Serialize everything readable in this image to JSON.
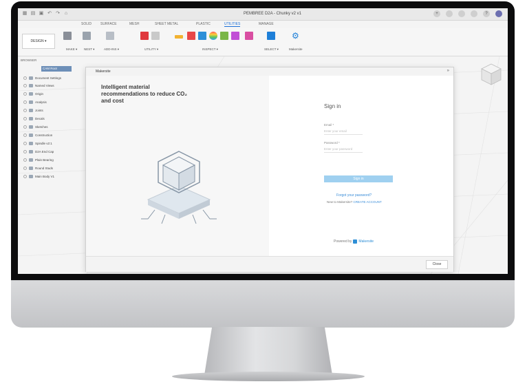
{
  "window": {
    "title": "PEMBREE D2A - Chunky v2 v1"
  },
  "tabs": [
    "SOLID",
    "SURFACE",
    "MESH",
    "SHEET METAL",
    "PLASTIC",
    "UTILITIES",
    "MANAGE"
  ],
  "active_tab": "UTILITIES",
  "toolbar": {
    "design_label": "DESIGN ▾",
    "groups": [
      "MAKE ▾",
      "NEST ▾",
      "ADD-INS ▾",
      "UTILITY ▾",
      "INSPECT ▾",
      "SELECT ▾",
      "Makersite"
    ]
  },
  "browser": {
    "header": "BROWSER",
    "root": "CAM Root",
    "items": [
      "Document Settings",
      "Named Views",
      "Origin",
      "Analysis",
      "Joints",
      "Decals",
      "Sketches",
      "Construction",
      "Spindle v2:1",
      "D2A End Cap",
      "Plain Bearing",
      "Round Studs",
      "Main Body V1"
    ]
  },
  "dialog": {
    "title": "Makersite",
    "pitch_line1": "Intelligent material",
    "pitch_line2": "recommendations to reduce CO₂",
    "pitch_line3": "and cost",
    "signin_title": "Sign in",
    "email_label": "Email *",
    "email_placeholder": "Enter your email",
    "password_label": "Password *",
    "password_placeholder": "Enter your password",
    "signin_button": "Sign in",
    "forgot_link": "Forgot your password?",
    "new_user_text": "New to Makersite?",
    "create_account_link": "CREATE ACCOUNT",
    "powered_by": "Powered by",
    "brand": "Makersite",
    "close_button": "Close"
  }
}
